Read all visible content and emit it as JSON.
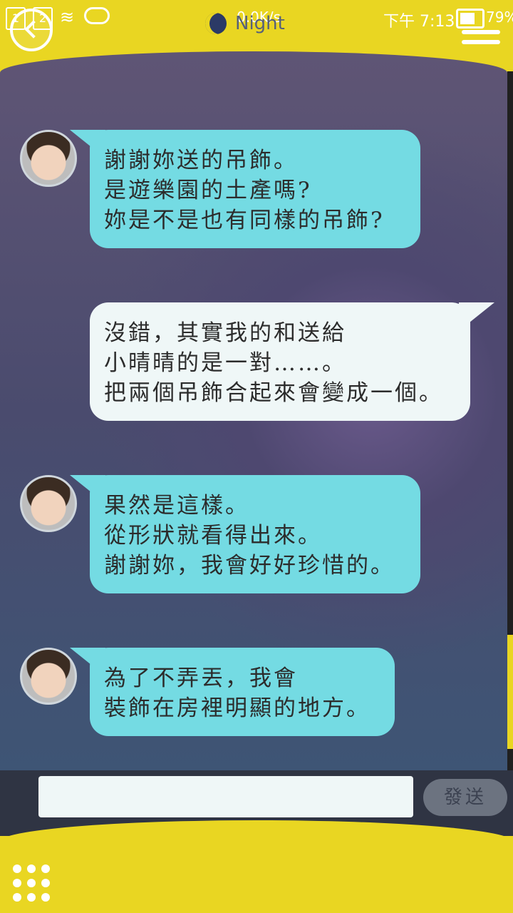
{
  "status_bar": {
    "sim1": "1",
    "sim2": "2",
    "net_speed": "0.0K/s",
    "time": "下午 7:13",
    "battery": "79%"
  },
  "header": {
    "mode_label": "Night",
    "icons": [
      "back-icon",
      "moon-icon",
      "menu-icon"
    ]
  },
  "messages": [
    {
      "side": "in",
      "lines": [
        "謝謝妳送的吊飾。",
        "是遊樂園的土產嗎?",
        "妳是不是也有同樣的吊飾?"
      ]
    },
    {
      "side": "out",
      "lines": [
        "沒錯，其實我的和送給",
        "小晴晴的是一對……。",
        "把兩個吊飾合起來會變成一個。"
      ]
    },
    {
      "side": "in",
      "lines": [
        "果然是這樣。",
        "從形狀就看得出來。",
        "謝謝妳，我會好好珍惜的。"
      ]
    },
    {
      "side": "in",
      "lines": [
        "為了不弄丟，我會",
        "裝飾在房裡明顯的地方。"
      ]
    }
  ],
  "input": {
    "value": "",
    "send_label": "發送"
  },
  "colors": {
    "accent_yellow": "#e9d622",
    "incoming_bubble": "#74dbe3",
    "outgoing_bubble": "#eff7f7"
  }
}
